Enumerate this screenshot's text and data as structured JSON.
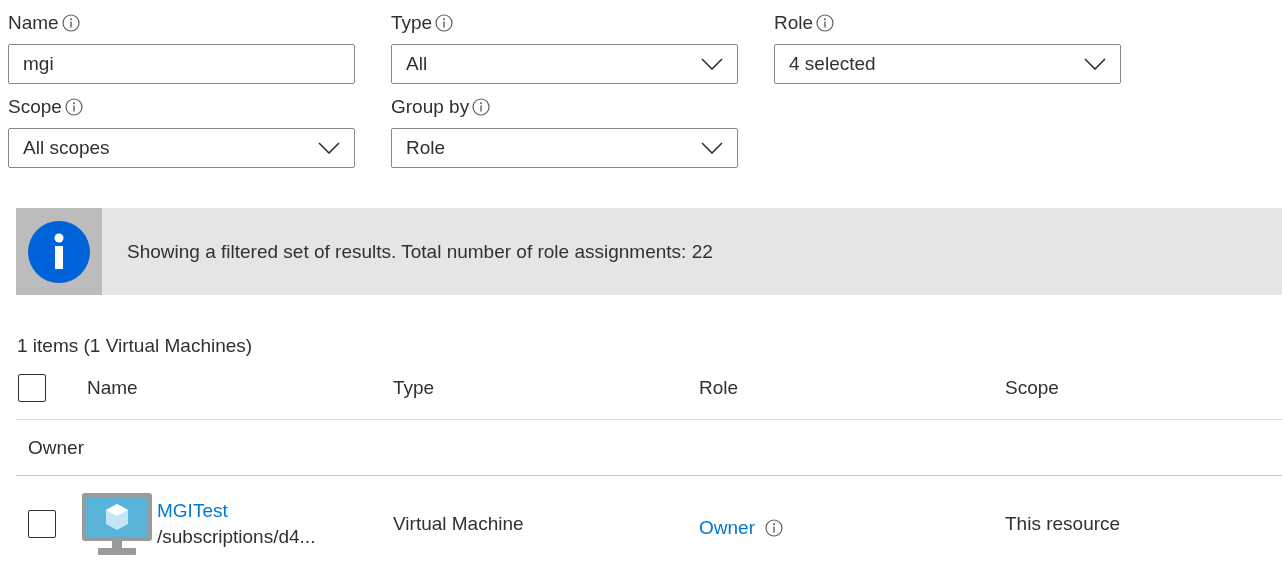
{
  "filters": [
    {
      "label": "Name",
      "kind": "text",
      "value": "mgi"
    },
    {
      "label": "Type",
      "kind": "dropdown",
      "value": "All"
    },
    {
      "label": "Role",
      "kind": "dropdown",
      "value": "4 selected"
    },
    {
      "label": "Scope",
      "kind": "dropdown",
      "value": "All scopes"
    },
    {
      "label": "Group by",
      "kind": "dropdown",
      "value": "Role"
    }
  ],
  "banner": {
    "text": "Showing a filtered set of results. Total number of role assignments: 22"
  },
  "summary": "1 items (1 Virtual Machines)",
  "table": {
    "select_all": {
      "checked": false
    },
    "columns": [
      "Name",
      "Type",
      "Role",
      "Scope"
    ],
    "groups": [
      {
        "label": "Owner",
        "rows": [
          {
            "checked": false,
            "name": "MGITest",
            "path": "/subscriptions/d4...",
            "type": "Virtual Machine",
            "role": "Owner",
            "scope": "This resource"
          }
        ]
      }
    ]
  }
}
